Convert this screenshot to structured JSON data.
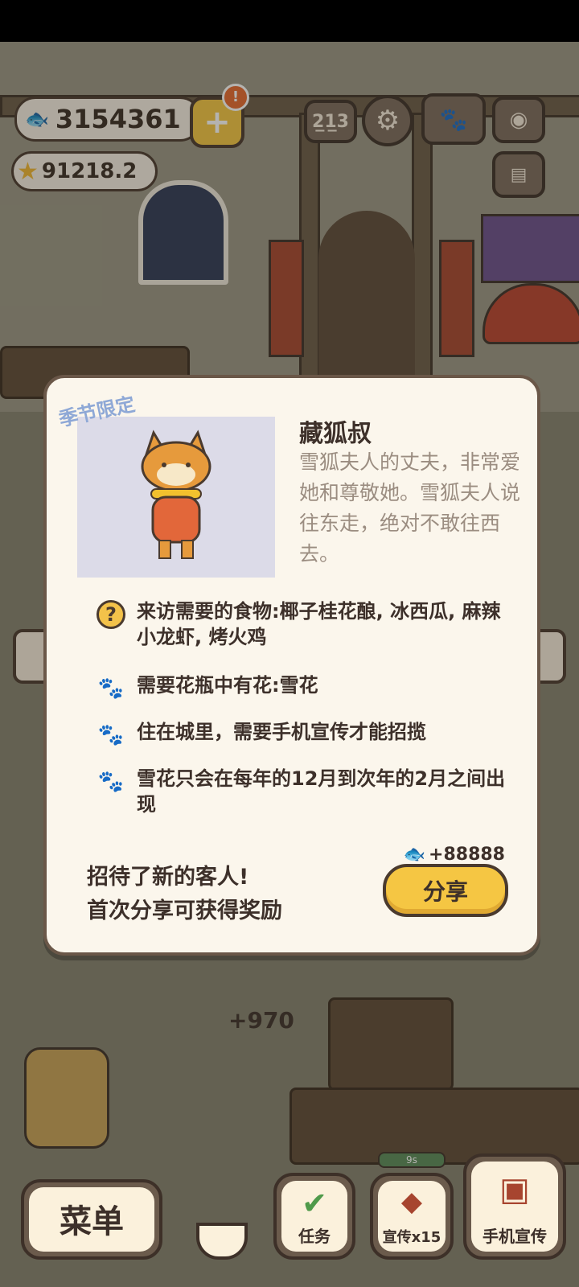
{
  "hud": {
    "fish_currency": "3154361",
    "star_currency": "91218.2",
    "add_badge": "!"
  },
  "top_icons": [
    "ranking-icon",
    "settings-gear-icon",
    "paw-book-icon",
    "camera-icon",
    "newspaper-icon"
  ],
  "modal": {
    "season_tag": "季节限定",
    "character_name": "藏狐叔",
    "description": "雪狐夫人的丈夫，非常爱她和尊敬她。雪狐夫人说往东走，绝对不敢往西去。",
    "requirements": [
      {
        "icon": "question-icon",
        "text": "来访需要的食物:椰子桂花酿, 冰西瓜, 麻辣小龙虾, 烤火鸡"
      },
      {
        "icon": "paw-icon",
        "text": "需要花瓶中有花:雪花"
      },
      {
        "icon": "paw-icon",
        "text": "住在城里，需要手机宣传才能招揽"
      },
      {
        "icon": "paw-icon",
        "text": "雪花只会在每年的12月到次年的2月之间出现"
      }
    ],
    "reward": "+88888",
    "new_guest_line1": "招待了新的客人!",
    "new_guest_line2": "首次分享可获得奖励",
    "share_label": "分享"
  },
  "scene": {
    "floating_score": "+970",
    "timer": "9s"
  },
  "bottom_bar": {
    "menu_label": "菜单",
    "task_label": "任务",
    "promo_label": "宣传x15",
    "phone_promo_label": "手机宣传"
  },
  "colors": {
    "accent_yellow": "#f5c643",
    "panel_bg": "#fbf6ec",
    "text_dark": "#3d302a",
    "season_blue": "#8ea8d6"
  }
}
